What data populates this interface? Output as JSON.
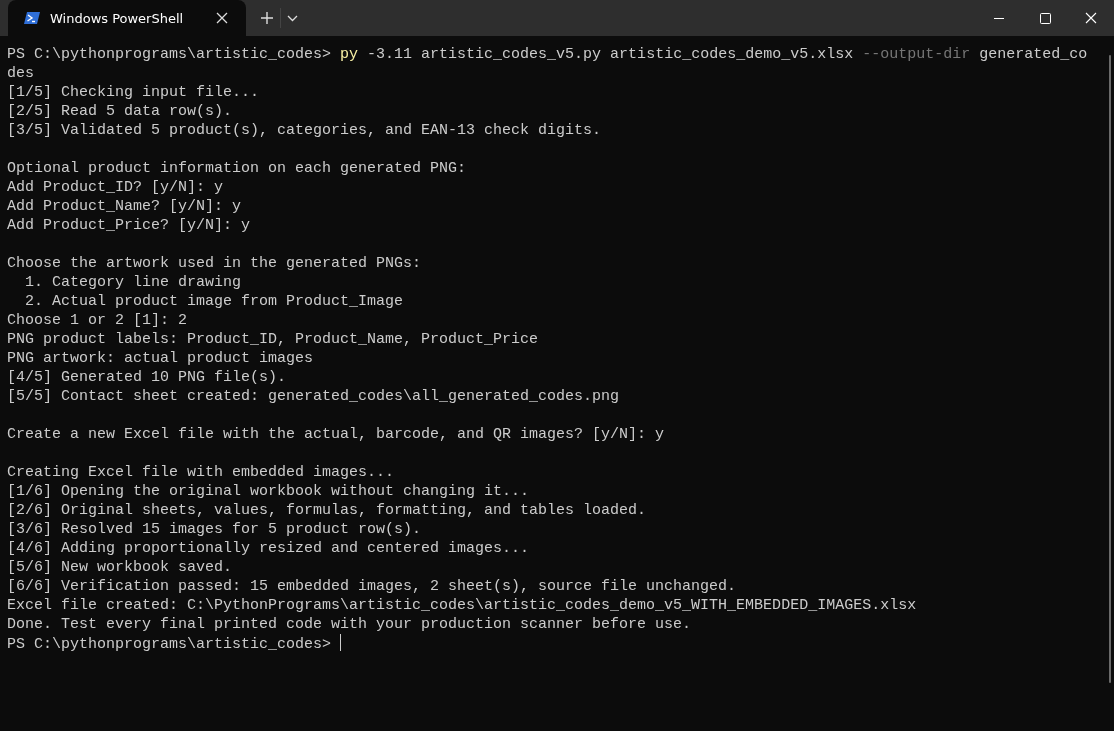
{
  "window": {
    "tabs": [
      {
        "title": "Windows PowerShell",
        "selected": true
      }
    ]
  },
  "terminal": {
    "lines": [
      {
        "kind": "command",
        "segments": [
          {
            "text": "PS C:\\pythonprograms\\artistic_codes> ",
            "kind": "plain"
          },
          {
            "text": "py",
            "kind": "command"
          },
          {
            "text": " -3.11 artistic_codes_v5.py artistic_codes_demo_v5.xlsx ",
            "kind": "plain"
          },
          {
            "text": "--output-dir",
            "kind": "flag"
          },
          {
            "text": " generated_co",
            "kind": "plain"
          }
        ]
      },
      {
        "kind": "output",
        "text": "des"
      },
      {
        "kind": "output",
        "text": "[1/5] Checking input file..."
      },
      {
        "kind": "output",
        "text": "[2/5] Read 5 data row(s)."
      },
      {
        "kind": "output",
        "text": "[3/5] Validated 5 product(s), categories, and EAN-13 check digits."
      },
      {
        "kind": "blank"
      },
      {
        "kind": "output",
        "text": "Optional product information on each generated PNG:"
      },
      {
        "kind": "output",
        "text": "Add Product_ID? [y/N]: y"
      },
      {
        "kind": "output",
        "text": "Add Product_Name? [y/N]: y"
      },
      {
        "kind": "output",
        "text": "Add Product_Price? [y/N]: y"
      },
      {
        "kind": "blank"
      },
      {
        "kind": "output",
        "text": "Choose the artwork used in the generated PNGs:"
      },
      {
        "kind": "output",
        "text": "  1. Category line drawing"
      },
      {
        "kind": "output",
        "text": "  2. Actual product image from Product_Image"
      },
      {
        "kind": "output",
        "text": "Choose 1 or 2 [1]: 2"
      },
      {
        "kind": "output",
        "text": "PNG product labels: Product_ID, Product_Name, Product_Price"
      },
      {
        "kind": "output",
        "text": "PNG artwork: actual product images"
      },
      {
        "kind": "output",
        "text": "[4/5] Generated 10 PNG file(s)."
      },
      {
        "kind": "output",
        "text": "[5/5] Contact sheet created: generated_codes\\all_generated_codes.png"
      },
      {
        "kind": "blank"
      },
      {
        "kind": "output",
        "text": "Create a new Excel file with the actual, barcode, and QR images? [y/N]: y"
      },
      {
        "kind": "blank"
      },
      {
        "kind": "output",
        "text": "Creating Excel file with embedded images..."
      },
      {
        "kind": "output",
        "text": "[1/6] Opening the original workbook without changing it..."
      },
      {
        "kind": "output",
        "text": "[2/6] Original sheets, values, formulas, formatting, and tables loaded."
      },
      {
        "kind": "output",
        "text": "[3/6] Resolved 15 images for 5 product row(s)."
      },
      {
        "kind": "output",
        "text": "[4/6] Adding proportionally resized and centered images..."
      },
      {
        "kind": "output",
        "text": "[5/6] New workbook saved."
      },
      {
        "kind": "output",
        "text": "[6/6] Verification passed: 15 embedded images, 2 sheet(s), source file unchanged."
      },
      {
        "kind": "output",
        "text": "Excel file created: C:\\PythonPrograms\\artistic_codes\\artistic_codes_demo_v5_WITH_EMBEDDED_IMAGES.xlsx"
      },
      {
        "kind": "output",
        "text": "Done. Test every final printed code with your production scanner before use."
      },
      {
        "kind": "prompt",
        "text": "PS C:\\pythonprograms\\artistic_codes> "
      }
    ]
  }
}
